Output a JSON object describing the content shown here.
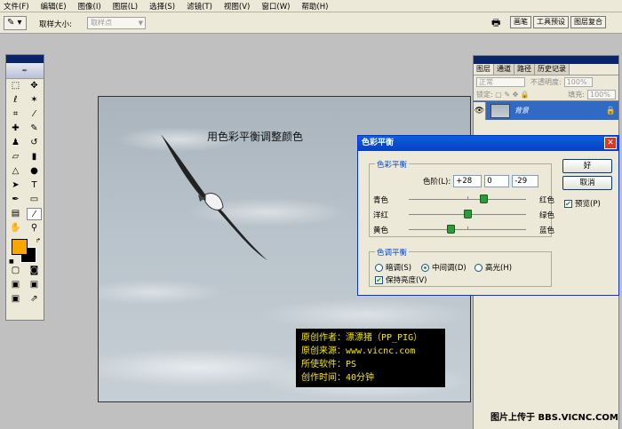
{
  "menu": [
    "文件(F)",
    "编辑(E)",
    "图像(I)",
    "图层(L)",
    "选择(S)",
    "滤镜(T)",
    "视图(V)",
    "窗口(W)",
    "帮助(H)"
  ],
  "options": {
    "tool_icon": "✎ ▾",
    "sample_size_label": "取样大小:",
    "sample_size_value": "取样点",
    "palette_well": [
      "画笔",
      "工具预设",
      "图层复合"
    ]
  },
  "document": {
    "caption": "用色彩平衡调整颜色"
  },
  "credits": [
    "原创作者：漂漂猪（PP_PIG）",
    "原创来源：www.vicnc.com",
    "所使软件：PS",
    "创作时间：40分钟"
  ],
  "layers_panel": {
    "tabs": [
      "图层",
      "通道",
      "路径",
      "历史记录"
    ],
    "blend_mode": "正常",
    "opacity_label": "不透明度:",
    "opacity_value": "100%",
    "lock_label": "锁定:",
    "fill_label": "填充:",
    "fill_value": "100%",
    "layer_name": "背景"
  },
  "dialog": {
    "title": "色彩平衡",
    "close": "✕",
    "balance_group": "色彩平衡",
    "levels_label": "色阶(L):",
    "levels": [
      "+28",
      "0",
      "-29"
    ],
    "sliders": [
      {
        "left": "青色",
        "right": "红色",
        "value": 28
      },
      {
        "left": "洋红",
        "right": "绿色",
        "value": 0
      },
      {
        "left": "黄色",
        "right": "蓝色",
        "value": -29
      }
    ],
    "tone_group": "色调平衡",
    "tones": [
      "暗调(S)",
      "中间调(D)",
      "高光(H)"
    ],
    "selected_tone": "中间调(D)",
    "preserve": "保持亮度(V)",
    "ok": "好",
    "cancel": "取消",
    "preview": "预览(P)"
  },
  "watermark": "图片上传于 BBS.VICNC.COM"
}
